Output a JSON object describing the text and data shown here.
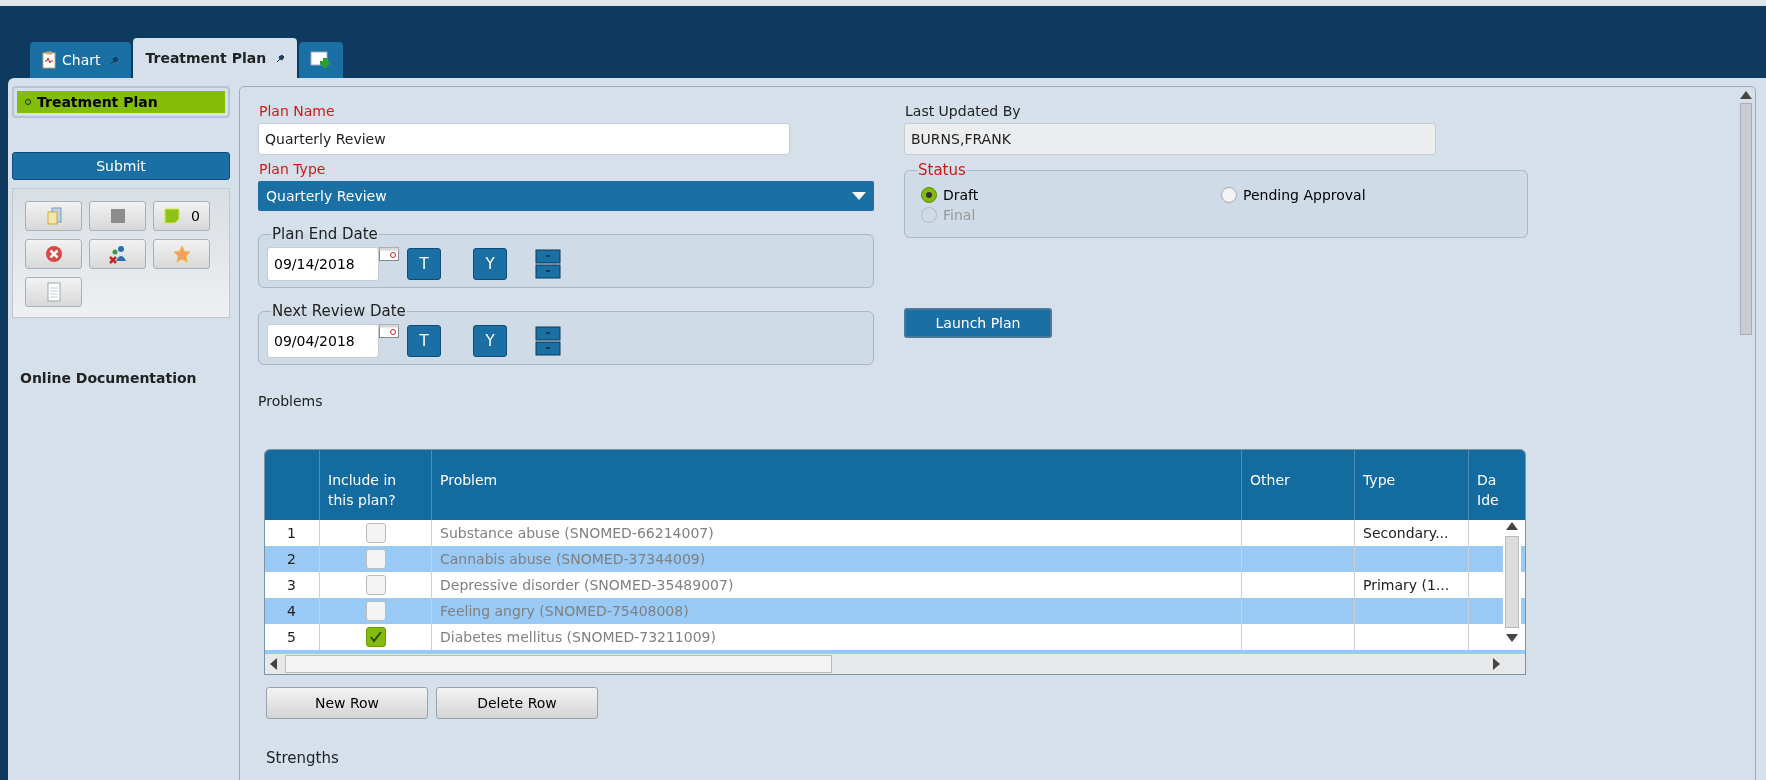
{
  "tabs": [
    {
      "label": "Chart",
      "kind": "clipboard",
      "selected": false
    },
    {
      "label": "Treatment Plan",
      "kind": "plain",
      "selected": true
    }
  ],
  "sidebar": {
    "nav_items": [
      {
        "label": "Treatment Plan",
        "selected": true
      }
    ],
    "submit": "Submit",
    "tools": [
      {
        "kind": "documents"
      },
      {
        "kind": "square"
      },
      {
        "kind": "note",
        "count": "0"
      },
      {
        "kind": "cancel"
      },
      {
        "kind": "people"
      },
      {
        "kind": "star"
      },
      {
        "kind": "page"
      }
    ],
    "link": "Online Documentation"
  },
  "form": {
    "plan_name": {
      "label": "Plan Name",
      "value": "Quarterly Review"
    },
    "plan_type": {
      "label": "Plan Type",
      "value": "Quarterly Review"
    },
    "last_updated_by": {
      "label": "Last Updated By",
      "value": "BURNS,FRANK"
    },
    "status": {
      "label": "Status",
      "options": [
        {
          "label": "Draft",
          "selected": true,
          "disabled": false
        },
        {
          "label": "Pending Approval",
          "selected": false,
          "disabled": false
        },
        {
          "label": "Final",
          "selected": false,
          "disabled": true
        }
      ]
    },
    "dates": [
      {
        "label": "Plan End Date",
        "value": "09/14/2018",
        "today": "T",
        "yesterday": "Y"
      },
      {
        "label": "Next Review Date",
        "value": "09/04/2018",
        "today": "T",
        "yesterday": "Y"
      }
    ],
    "launch": "Launch Plan"
  },
  "problems": {
    "title": "Problems",
    "columns": [
      "",
      "Include in this plan?",
      "Problem",
      "Other",
      "Type",
      "Da Ide"
    ],
    "rows": [
      {
        "number": "1",
        "included": false,
        "problem": "Substance abuse (SNOMED-66214007)",
        "other": "",
        "type": "Secondary..."
      },
      {
        "number": "2",
        "included": false,
        "problem": "Cannabis abuse (SNOMED-37344009)",
        "other": "",
        "type": ""
      },
      {
        "number": "3",
        "included": false,
        "problem": "Depressive disorder (SNOMED-35489007)",
        "other": "",
        "type": "Primary (1..."
      },
      {
        "number": "4",
        "included": false,
        "problem": "Feeling angry (SNOMED-75408008)",
        "other": "",
        "type": ""
      },
      {
        "number": "5",
        "included": true,
        "problem": "Diabetes mellitus (SNOMED-73211009)",
        "other": "",
        "type": ""
      }
    ],
    "buttons": [
      "New Row",
      "Delete Row"
    ]
  },
  "strengths": {
    "title": "Strengths"
  }
}
